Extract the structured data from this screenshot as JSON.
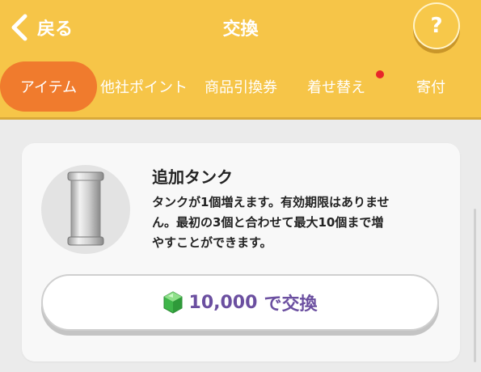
{
  "header": {
    "back_label": "戻る",
    "title": "交換",
    "help_label": "?",
    "background": "#f6c548"
  },
  "tabs": [
    {
      "label": "アイテム",
      "active": true
    },
    {
      "label": "他社ポイント",
      "active": false
    },
    {
      "label": "商品引換券",
      "active": false
    },
    {
      "label": "着せ替え",
      "active": false,
      "has_badge": true
    },
    {
      "label": "寄付",
      "active": false
    }
  ],
  "item": {
    "name": "追加タンク",
    "description_lines": [
      "タンクが1個増えます。有効期限はありませ",
      "ん。最初の3個と合わせて最大10個まで増",
      "やすことができます。"
    ],
    "icon": "tank-icon",
    "button": {
      "price": "10,000",
      "suffix": "で交換",
      "currency_icon": "green-gem-icon"
    }
  },
  "colors": {
    "accent": "#f07b2d",
    "price_text": "#6b4fa0",
    "badge": "#e8262a"
  }
}
